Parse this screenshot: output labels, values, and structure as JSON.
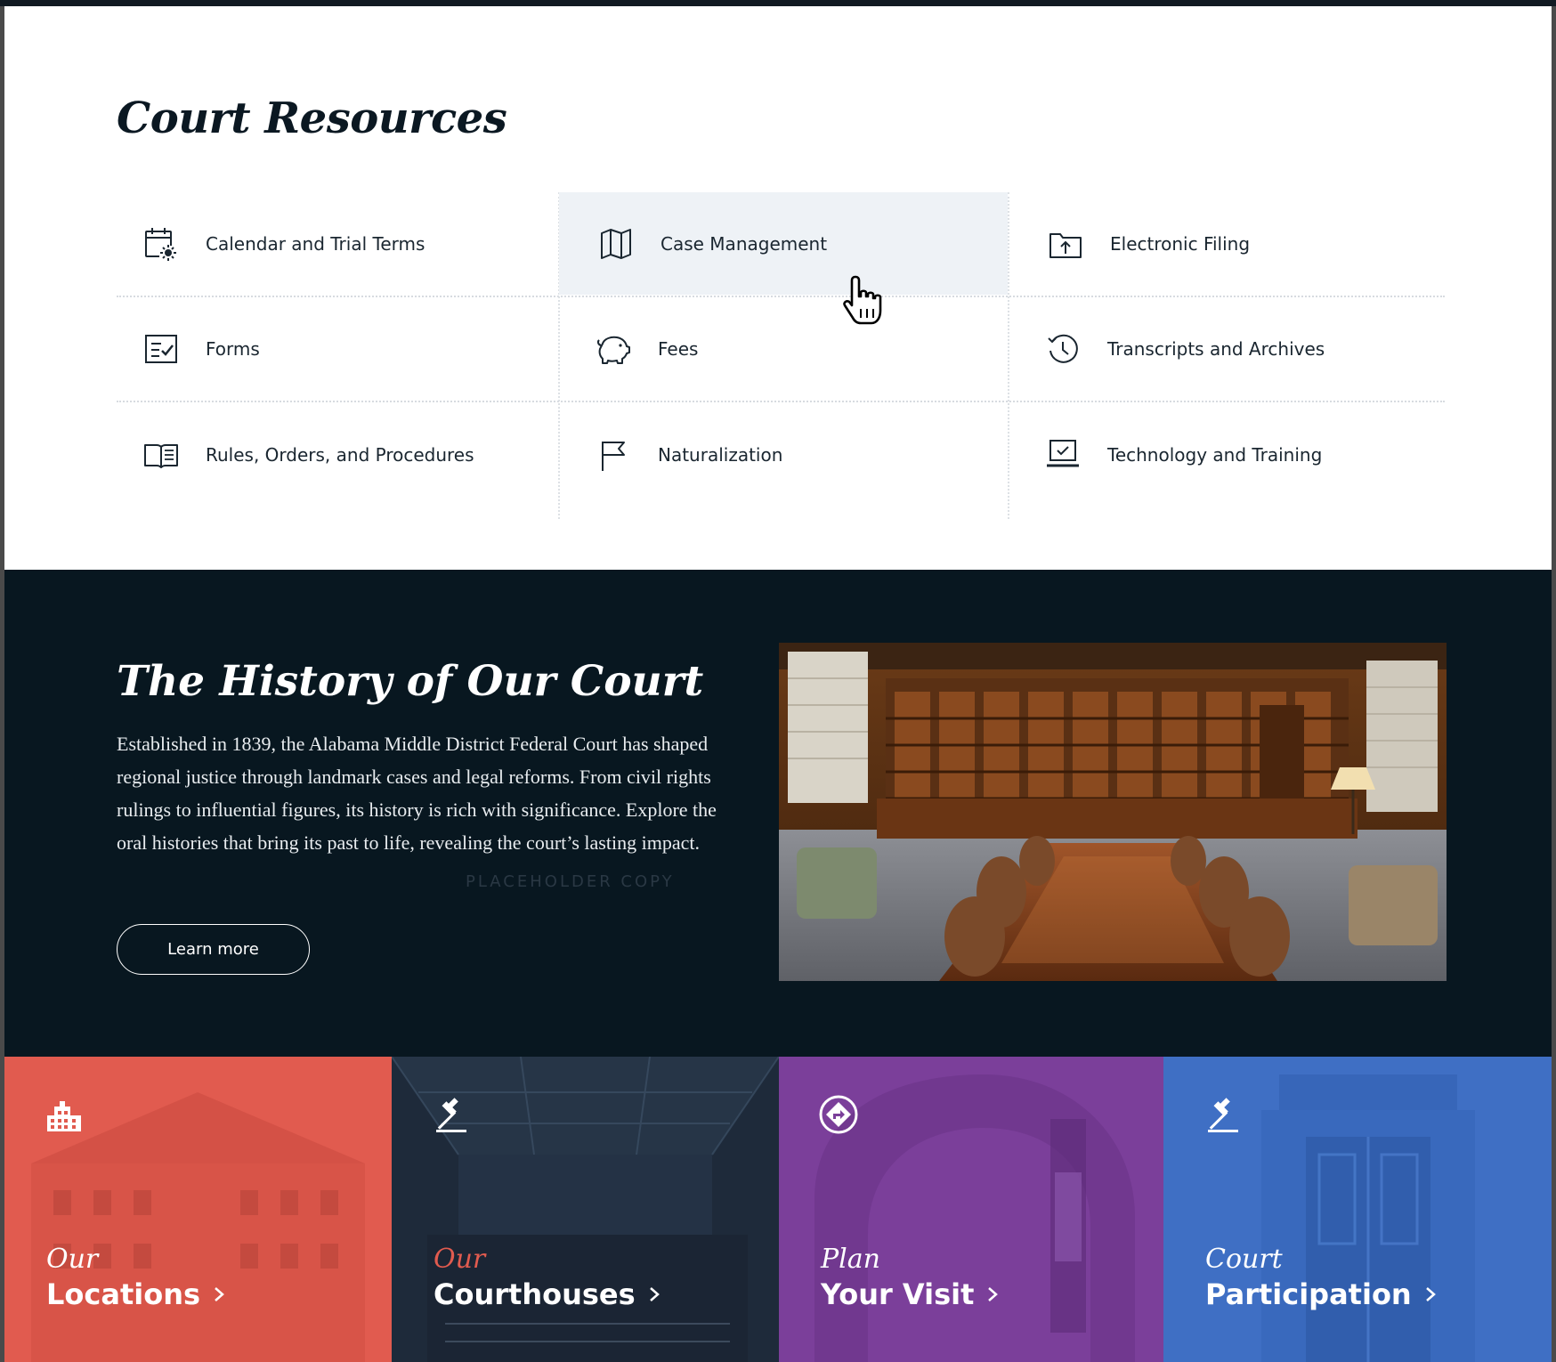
{
  "resources": {
    "title": "Court Resources",
    "items": [
      {
        "label": "Calendar and Trial Terms",
        "icon": "calendar-sun-icon"
      },
      {
        "label": "Case Management",
        "icon": "map-icon"
      },
      {
        "label": "Electronic Filing",
        "icon": "folder-upload-icon"
      },
      {
        "label": "Forms",
        "icon": "checklist-form-icon"
      },
      {
        "label": "Fees",
        "icon": "piggy-bank-icon"
      },
      {
        "label": "Transcripts and Archives",
        "icon": "history-clock-icon"
      },
      {
        "label": "Rules, Orders, and Procedures",
        "icon": "open-book-icon"
      },
      {
        "label": "Naturalization",
        "icon": "flag-icon"
      },
      {
        "label": "Technology and Training",
        "icon": "laptop-check-icon"
      }
    ]
  },
  "history": {
    "title": "The History of Our Court",
    "body": "Established in 1839, the Alabama Middle District Federal Court has shaped regional justice through landmark cases and legal reforms. From civil rights rulings to influential figures, its history is rich with significance. Explore the oral histories that bring its past to life, revealing the court’s lasting impact.",
    "placeholder": "PLACEHOLDER COPY",
    "button": "Learn more"
  },
  "tiles": [
    {
      "small": "Our",
      "big": "Locations",
      "icon": "building-icon",
      "color": "#e15b4f"
    },
    {
      "small": "Our",
      "big": "Courthouses",
      "icon": "gavel-icon",
      "color": "#1e2a3a"
    },
    {
      "small": "Plan",
      "big": "Your Visit",
      "icon": "directions-icon",
      "color": "#7b3f9a"
    },
    {
      "small": "Court",
      "big": "Participation",
      "icon": "gavel-icon",
      "color": "#3f6fc4"
    }
  ],
  "colors": {
    "navy": "#081720",
    "hover": "#eef2f6",
    "our_courthouses_accent": "#e15b4f"
  }
}
